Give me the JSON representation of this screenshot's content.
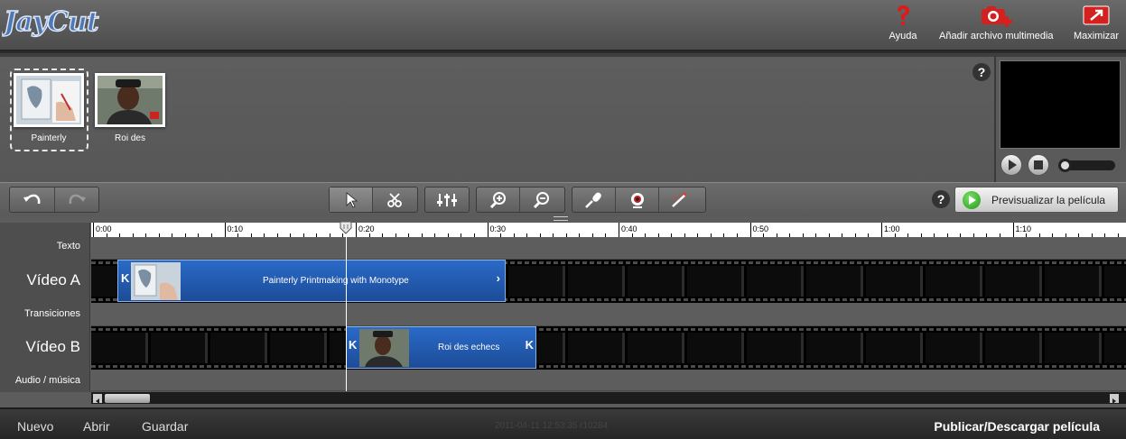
{
  "app": {
    "logo_text": "JayCut"
  },
  "top_actions": [
    {
      "label": "Ayuda",
      "icon": "help-icon"
    },
    {
      "label": "Añadir archivo multimedia",
      "icon": "add-media-camera-icon"
    },
    {
      "label": "Maximizar",
      "icon": "maximize-icon"
    }
  ],
  "library": {
    "items": [
      {
        "caption": "Painterly",
        "selected": true
      },
      {
        "caption": "Roi des",
        "selected": false
      }
    ]
  },
  "preview": {
    "volume_level": 0.0
  },
  "toolbar": {
    "preview_label": "Previsualizar la película"
  },
  "timeline": {
    "track_labels": [
      "Texto",
      "Vídeo A",
      "Transiciones",
      "Vídeo B",
      "Audio / música"
    ],
    "ruler_labels": [
      "0:00",
      "0:10",
      "0:20",
      "0:30",
      "0:40",
      "0:50",
      "1:00",
      "1:10"
    ],
    "clips": {
      "video_a": {
        "title": "Painterly Printmaking with Monotype"
      },
      "video_b": {
        "title": "Roi des echecs"
      }
    }
  },
  "footer": {
    "new_label": "Nuevo",
    "open_label": "Abrir",
    "save_label": "Guardar",
    "stamp": "2011-04-11 12:53:35 r10284",
    "publish_label": "Publicar/Descargar película"
  },
  "colors": {
    "clip_blue": "#1f5aaf",
    "play_green": "#1f9a16"
  }
}
